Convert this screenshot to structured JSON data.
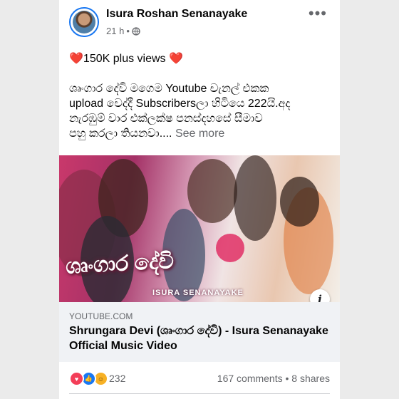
{
  "post": {
    "author": "Isura Roshan Senanayake",
    "time": "21 h",
    "separator": "•",
    "more_label": "•••",
    "lines": [
      {
        "heart_left": "❤️",
        "text": "150K plus views ",
        "heart_right": "❤️"
      },
      {
        "text": ""
      },
      {
        "text": "ශෘංගාර දේවි මගෙම Youtube චැනල් එකක"
      },
      {
        "text": "upload වෙද්දී Subscribersලා හිටියෙ 222යි.අද"
      },
      {
        "text": "නැරඹුම් වාර එක්ලක්ෂ පනස්දහසේ සීමාව"
      },
      {
        "text": "පහු කරලා තියනවා....",
        "see_more": "See more"
      }
    ]
  },
  "media": {
    "title_text": "ශෘංගාර  දේවි",
    "subtitle": "ISURA SENANAYAKE",
    "info_label": "i"
  },
  "link": {
    "domain": "YOUTUBE.COM",
    "title": "Shrungara Devi (ශෘංගාර දේවි) - Isura Senanayake Official Music Video"
  },
  "engagement": {
    "reaction_count": "232",
    "comments": "167 comments",
    "dot": "•",
    "shares": "8 shares",
    "reactions": [
      {
        "name": "love",
        "glyph": "♥",
        "color": "#f33e58"
      },
      {
        "name": "like",
        "glyph": "👍",
        "color": "#1877f2"
      },
      {
        "name": "care",
        "glyph": "☺",
        "color": "#f7b125"
      }
    ]
  },
  "colors": {
    "accent": "#1877f2",
    "muted": "#65676b"
  }
}
